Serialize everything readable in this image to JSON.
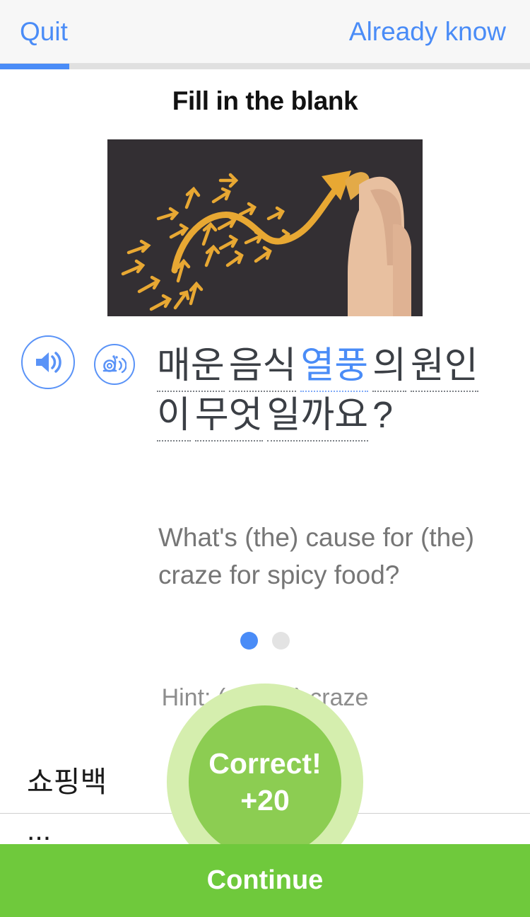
{
  "header": {
    "quit_label": "Quit",
    "already_know_label": "Already know",
    "accent_blue": "#4a8cf7"
  },
  "progress": {
    "percent": 13
  },
  "title": "Fill in the blank",
  "illustration": {
    "alt": "Hand drawing an upward orange chalk arrow among many small arrows on a dark chalkboard",
    "board_color": "#332f33",
    "chalk_color": "#e8a833"
  },
  "audio": {
    "normal_icon": "speaker-icon",
    "slow_icon": "snail-icon"
  },
  "sentence": {
    "words": [
      {
        "text": "매운",
        "highlighted": false
      },
      {
        "text": "음식",
        "highlighted": false
      },
      {
        "text": "열풍",
        "highlighted": true
      },
      {
        "text": "의",
        "highlighted": false
      },
      {
        "text": "원인",
        "highlighted": false
      },
      {
        "text": "이",
        "highlighted": false
      },
      {
        "text": "무엇",
        "highlighted": false
      },
      {
        "text": "일까요",
        "highlighted": false
      }
    ],
    "punctuation": "?",
    "answer_word": "열풍"
  },
  "translation": "What's (the) cause for (the) craze for spicy food?",
  "pagination": {
    "total": 2,
    "active_index": 0
  },
  "hint": {
    "prefix": "Hint:",
    "obscured": "(a wind)",
    "suffix": "craze",
    "full": "Hint: (a wind) craze"
  },
  "options": [
    {
      "label": "쇼핑백"
    },
    {
      "label": "..."
    }
  ],
  "feedback": {
    "result": "Correct!",
    "points": "+20",
    "halo_color": "#d5eeae",
    "core_color": "#8ccd52"
  },
  "continue": {
    "label": "Continue",
    "color": "#6fc93c"
  }
}
